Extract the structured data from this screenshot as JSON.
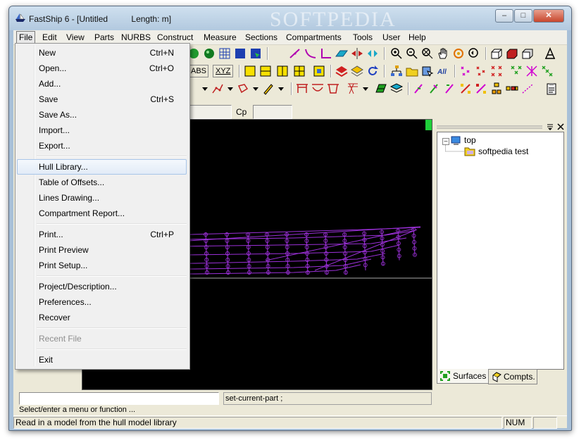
{
  "window": {
    "title": "FastShip 6 - [Untitled          Length: m]",
    "watermark": "SOFTPEDIA",
    "minimize_label": "–",
    "maximize_label": "□",
    "close_label": "✕"
  },
  "menubar": {
    "items": [
      "File",
      "Edit",
      "View",
      "Parts",
      "NURBS",
      "Construct",
      "Measure",
      "Sections",
      "Compartments",
      "Tools",
      "User",
      "Help"
    ]
  },
  "file_menu": {
    "items": [
      {
        "label": "New",
        "shortcut": "Ctrl+N"
      },
      {
        "label": "Open...",
        "shortcut": "Ctrl+O"
      },
      {
        "label": "Add...",
        "shortcut": ""
      },
      {
        "label": "Save",
        "shortcut": "Ctrl+S"
      },
      {
        "label": "Save As...",
        "shortcut": ""
      },
      {
        "label": "Import...",
        "shortcut": ""
      },
      {
        "label": "Export...",
        "shortcut": ""
      },
      {
        "label": "Hull Library...",
        "shortcut": ""
      },
      {
        "label": "Table of Offsets...",
        "shortcut": ""
      },
      {
        "label": "Lines Drawing...",
        "shortcut": ""
      },
      {
        "label": "Compartment Report...",
        "shortcut": ""
      },
      {
        "label": "Print...",
        "shortcut": "Ctrl+P"
      },
      {
        "label": "Print Preview",
        "shortcut": ""
      },
      {
        "label": "Print Setup...",
        "shortcut": ""
      },
      {
        "label": "Project/Description...",
        "shortcut": ""
      },
      {
        "label": "Preferences...",
        "shortcut": ""
      },
      {
        "label": "Recover",
        "shortcut": ""
      },
      {
        "label": "Recent File",
        "shortcut": ""
      },
      {
        "label": "Exit",
        "shortcut": ""
      }
    ],
    "highlighted": "Hull Library...",
    "disabled": "Recent File"
  },
  "toolbar": {
    "abs_label": "ABS",
    "xyz_label": "XYZ",
    "cp_label": "Cp"
  },
  "tree": {
    "root": "top",
    "child": "softpedia test",
    "expander": "–"
  },
  "side_tabs": {
    "surfaces": "Surfaces",
    "compts": "Compts."
  },
  "command": {
    "input_value": "",
    "history": "set-current-part ;",
    "prompt": "Select/enter a menu or function ..."
  },
  "status": {
    "message": "Read in a model from the hull model library",
    "num": "NUM"
  },
  "colors": {
    "hull_lines": "#9b30d8",
    "viewport_bg": "#000000",
    "menu_highlight": "#e2ebf7"
  }
}
